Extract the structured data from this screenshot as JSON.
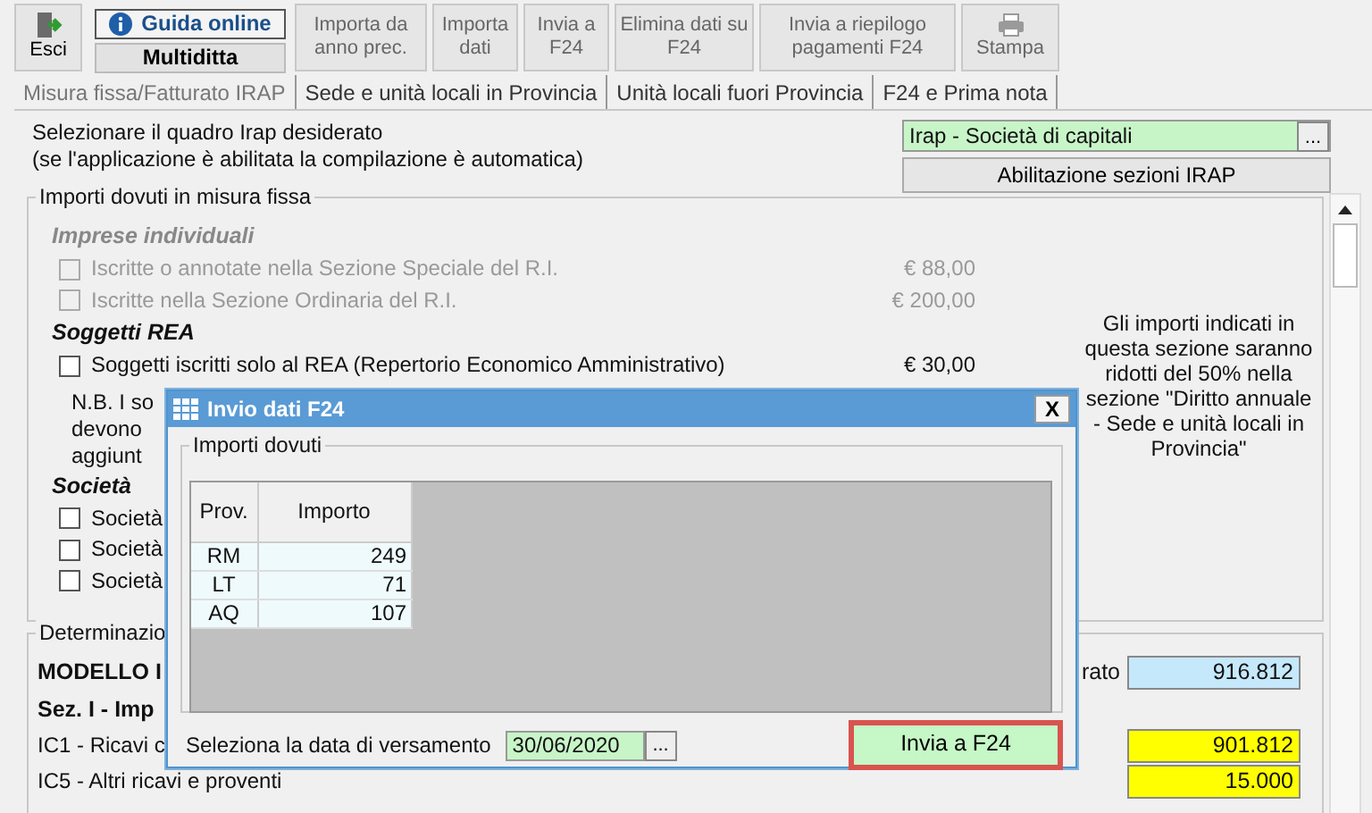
{
  "toolbar": {
    "exit": {
      "label": "Esci"
    },
    "help": {
      "label": "Guida online"
    },
    "company": {
      "label": "Multiditta"
    },
    "buttons": [
      {
        "label": "Importa da anno prec.",
        "disabled": true
      },
      {
        "label": "Importa dati",
        "disabled": true
      },
      {
        "label": "Invia a F24",
        "disabled": true
      },
      {
        "label": "Elimina dati su F24",
        "disabled": true
      },
      {
        "label": "Invia a riepilogo pagamenti F24",
        "disabled": true
      }
    ],
    "print": {
      "label": "Stampa",
      "disabled": true
    }
  },
  "tabs": [
    {
      "label": "Misura fissa/Fatturato IRAP",
      "selected": true
    },
    {
      "label": "Sede e unità locali in Provincia",
      "selected": false
    },
    {
      "label": "Unità locali fuori Provincia",
      "selected": false
    },
    {
      "label": "F24 e Prima nota",
      "selected": false
    }
  ],
  "quadro": {
    "prompt": "Selezionare il quadro Irap desiderato",
    "hint": "(se l'applicazione è abilitata la compilazione è automatica)",
    "value": "Irap - Società di capitali",
    "browse": "...",
    "enable_button": "Abilitazione sezioni IRAP"
  },
  "fixed_amounts": {
    "title": "Importi dovuti in misura fissa",
    "sections": [
      {
        "heading": "Imprese individuali",
        "disabled": true,
        "items": [
          {
            "label": "Iscritte o annotate nella Sezione Speciale del R.I.",
            "amount": "€ 88,00",
            "checked": false,
            "disabled": true
          },
          {
            "label": "Iscritte nella Sezione Ordinaria del R.I.",
            "amount": "€ 200,00",
            "checked": false,
            "disabled": true
          }
        ]
      },
      {
        "heading": "Soggetti REA",
        "disabled": false,
        "items": [
          {
            "label": "Soggetti iscritti solo al REA (Repertorio Economico Amministrativo)",
            "amount": "€ 30,00",
            "checked": false,
            "disabled": false
          }
        ],
        "note": [
          "N.B. I so",
          "devono",
          "aggiunt"
        ]
      },
      {
        "heading": "Società",
        "disabled": false,
        "items": [
          {
            "label": "Società",
            "checked": false,
            "disabled": false
          },
          {
            "label": "Società",
            "checked": false,
            "disabled": false
          },
          {
            "label": "Società",
            "checked": false,
            "disabled": false
          }
        ]
      }
    ],
    "side_note": "Gli importi indicati in questa sezione saranno ridotti del 50% nella sezione \"Diritto annuale - Sede e unità locali in Provincia\""
  },
  "determination": {
    "title": "Determinazio",
    "rows": [
      {
        "kind": "model",
        "label": "MODELLO I",
        "caption": "rato",
        "value": "916.812",
        "color": "#c6e8fb"
      },
      {
        "kind": "heading",
        "label": "Sez. I - Imp"
      },
      {
        "kind": "value",
        "label": "IC1 - Ricavi c",
        "value": "901.812",
        "color": "#ffff00"
      },
      {
        "kind": "value",
        "label": "IC5 - Altri ricavi e proventi",
        "value": "15.000",
        "color": "#ffff00"
      }
    ]
  },
  "dialog": {
    "title": "Invio dati F24",
    "close": "X",
    "group": "Importi dovuti",
    "columns": [
      "Prov.",
      "Importo"
    ],
    "rows": [
      [
        "RM",
        "249"
      ],
      [
        "LT",
        "71"
      ],
      [
        "AQ",
        "107"
      ]
    ],
    "date_label": "Seleziona la data di versamento",
    "date": "30/06/2020",
    "browse": "...",
    "send_button": "Invia a F24"
  }
}
